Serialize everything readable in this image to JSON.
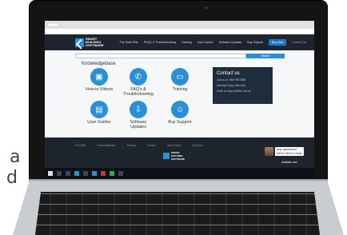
{
  "side_text": {
    "line1": "a",
    "line2": "d"
  },
  "browser": {
    "tab_label": "",
    "address": ""
  },
  "site": {
    "logo_line1": "SMART",
    "logo_line2": "BUILDING",
    "logo_line3": "SOFTWARE",
    "nav": [
      {
        "label": "Fire Suite Elite"
      },
      {
        "label": "PAQ's & Troubleshooting"
      },
      {
        "label": "Training"
      },
      {
        "label": "User Guides"
      },
      {
        "label": "Software Updates"
      },
      {
        "label": "Buy Support"
      }
    ],
    "nav_cta": "Buy Now",
    "nav_contact": "Contact Us",
    "search_placeholder": "",
    "search_button": "Search",
    "knowledgebase_title": "Knowledgebase",
    "tiles": [
      {
        "label": "How-to Videos",
        "icon": "video-icon"
      },
      {
        "label": "FAQ's & Troubleshooting",
        "icon": "phone-icon"
      },
      {
        "label": "Training",
        "icon": "monitor-icon"
      },
      {
        "label": "User Guides",
        "icon": "document-icon"
      },
      {
        "label": "Software Updates",
        "icon": "download-icon"
      },
      {
        "label": "Buy Support",
        "icon": "support-icon"
      }
    ],
    "contact": {
      "title": "Contact us",
      "line1": "Call us on 1800 955 5888",
      "line2": "Monday-Friday, 8am-5pm",
      "line3": "Email us support@fire.com.au"
    },
    "footer_links": [
      "Fire Suite",
      "Knowledgebase",
      "Training",
      "Contact",
      "User Guides",
      "Buy Now"
    ],
    "footer_copy": "",
    "chat": {
      "message_line1": "Any questions?",
      "message_line2": "We're here to help!",
      "status": "Available now"
    }
  },
  "colors": {
    "brand_blue": "#2b8fd6",
    "header_dark": "#1e2530",
    "contact_box": "#1f2c3d"
  }
}
